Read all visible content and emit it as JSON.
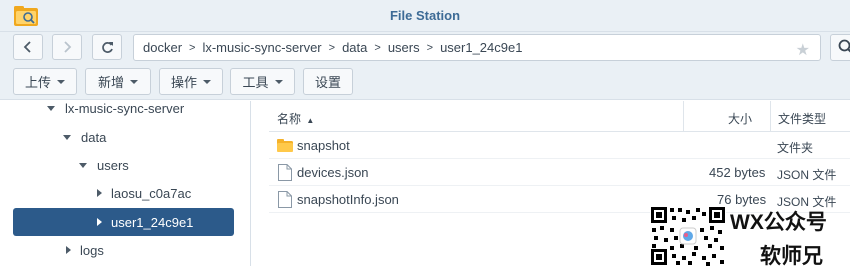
{
  "window": {
    "title": "File Station"
  },
  "nav": {
    "path": [
      "docker",
      "lx-music-sync-server",
      "data",
      "users",
      "user1_24c9e1"
    ]
  },
  "toolbar": {
    "upload": "上传",
    "create": "新增",
    "action": "操作",
    "tools": "工具",
    "settings": "设置"
  },
  "tree": {
    "items": [
      {
        "label": "lx-music-sync-server",
        "expanded": true
      },
      {
        "label": "data",
        "expanded": true
      },
      {
        "label": "users",
        "expanded": true
      },
      {
        "label": "laosu_c0a7ac",
        "expanded": false
      },
      {
        "label": "user1_24c9e1",
        "expanded": false,
        "selected": true
      },
      {
        "label": "logs",
        "expanded": false
      }
    ]
  },
  "files": {
    "columns": {
      "name": "名称",
      "size": "大小",
      "type": "文件类型"
    },
    "rows": [
      {
        "name": "snapshot",
        "size": "",
        "type": "文件夹",
        "icon": "folder-icon"
      },
      {
        "name": "devices.json",
        "size": "452 bytes",
        "type": "JSON 文件",
        "icon": "file-icon"
      },
      {
        "name": "snapshotInfo.json",
        "size": "76 bytes",
        "type": "JSON 文件",
        "icon": "file-icon"
      }
    ]
  },
  "watermark": {
    "title": "WX公众号",
    "subtitle": "软师兄"
  },
  "colors": {
    "accent": "#3d6b96",
    "selected": "#2c5a8a",
    "folder": "#f5b22a"
  }
}
